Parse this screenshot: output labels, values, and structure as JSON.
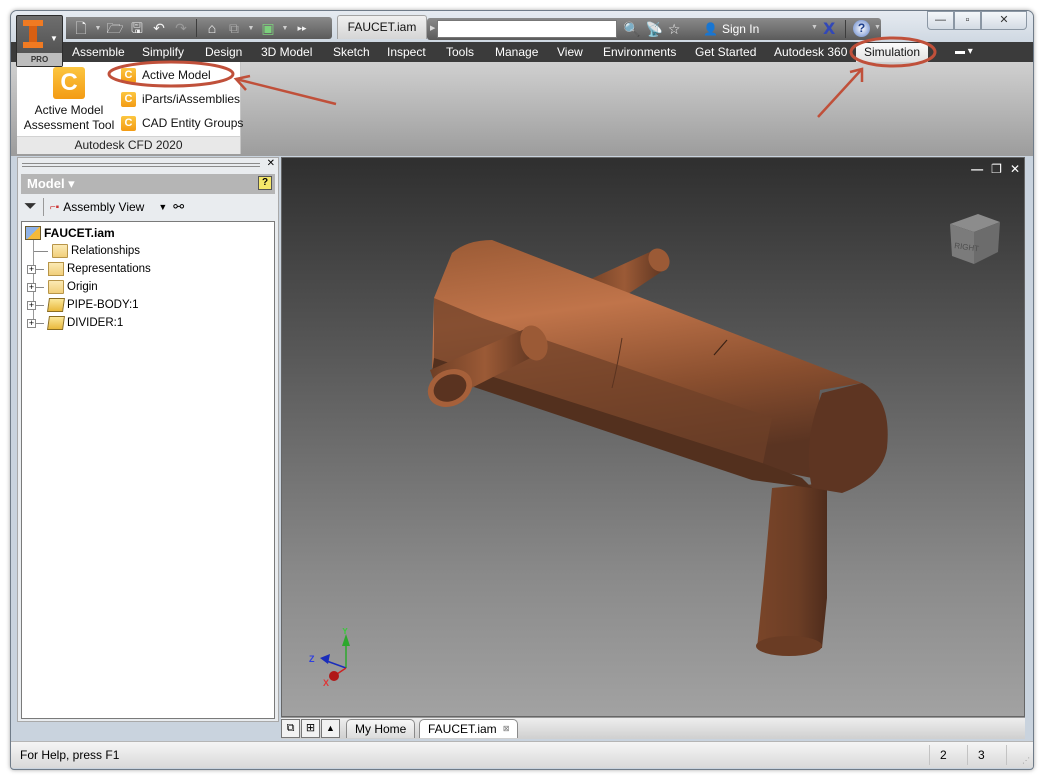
{
  "app": {
    "edition_badge": "PRO",
    "document_title": "FAUCET.iam"
  },
  "quick_access": {
    "icons": [
      "new-icon",
      "open-icon",
      "save-icon",
      "undo-icon",
      "redo-icon",
      "home-icon",
      "update-icon",
      "select-icon",
      "more-icon"
    ]
  },
  "search": {
    "value": "",
    "placeholder": ""
  },
  "account": {
    "sign_in_label": "Sign In"
  },
  "window_controls": {
    "minimize": "—",
    "maximize": "▫",
    "close": "✕"
  },
  "ribbon_tabs": [
    {
      "label": "Assemble",
      "active": false
    },
    {
      "label": "Simplify",
      "active": false
    },
    {
      "label": "Design",
      "active": false
    },
    {
      "label": "3D Model",
      "active": false
    },
    {
      "label": "Sketch",
      "active": false
    },
    {
      "label": "Inspect",
      "active": false
    },
    {
      "label": "Tools",
      "active": false
    },
    {
      "label": "Manage",
      "active": false
    },
    {
      "label": "View",
      "active": false
    },
    {
      "label": "Environments",
      "active": false
    },
    {
      "label": "Get Started",
      "active": false
    },
    {
      "label": "Autodesk 360",
      "active": false
    },
    {
      "label": "Simulation",
      "active": true
    }
  ],
  "ribbon_panel": {
    "title": "Autodesk CFD 2020",
    "big_button": {
      "line1": "Active Model",
      "line2": "Assessment Tool"
    },
    "small_buttons": [
      {
        "label": "Active Model",
        "highlighted": true
      },
      {
        "label": "iParts/iAssemblies",
        "highlighted": false
      },
      {
        "label": "CAD Entity Groups",
        "highlighted": false
      }
    ]
  },
  "annotations": {
    "color": "#c0503a"
  },
  "browser": {
    "title": "Model",
    "view_label": "Assembly View",
    "tree": [
      {
        "label": "FAUCET.iam",
        "type": "assembly",
        "expandable": false,
        "root": true
      },
      {
        "label": "Relationships",
        "type": "folder",
        "expandable": false
      },
      {
        "label": "Representations",
        "type": "representations",
        "expandable": true
      },
      {
        "label": "Origin",
        "type": "folder",
        "expandable": true
      },
      {
        "label": "PIPE-BODY:1",
        "type": "part",
        "expandable": true
      },
      {
        "label": "DIVIDER:1",
        "type": "part",
        "expandable": true
      }
    ]
  },
  "viewport": {
    "viewcube_face": "RIGHT",
    "triad_axes": {
      "x": "X",
      "y": "Y",
      "z": "Z"
    },
    "model_color": "#a8603a"
  },
  "document_tabs": [
    {
      "label": "My Home",
      "active": false
    },
    {
      "label": "FAUCET.iam",
      "active": true
    }
  ],
  "status_bar": {
    "help_text": "For Help, press F1",
    "cell_1": "2",
    "cell_2": "3"
  }
}
